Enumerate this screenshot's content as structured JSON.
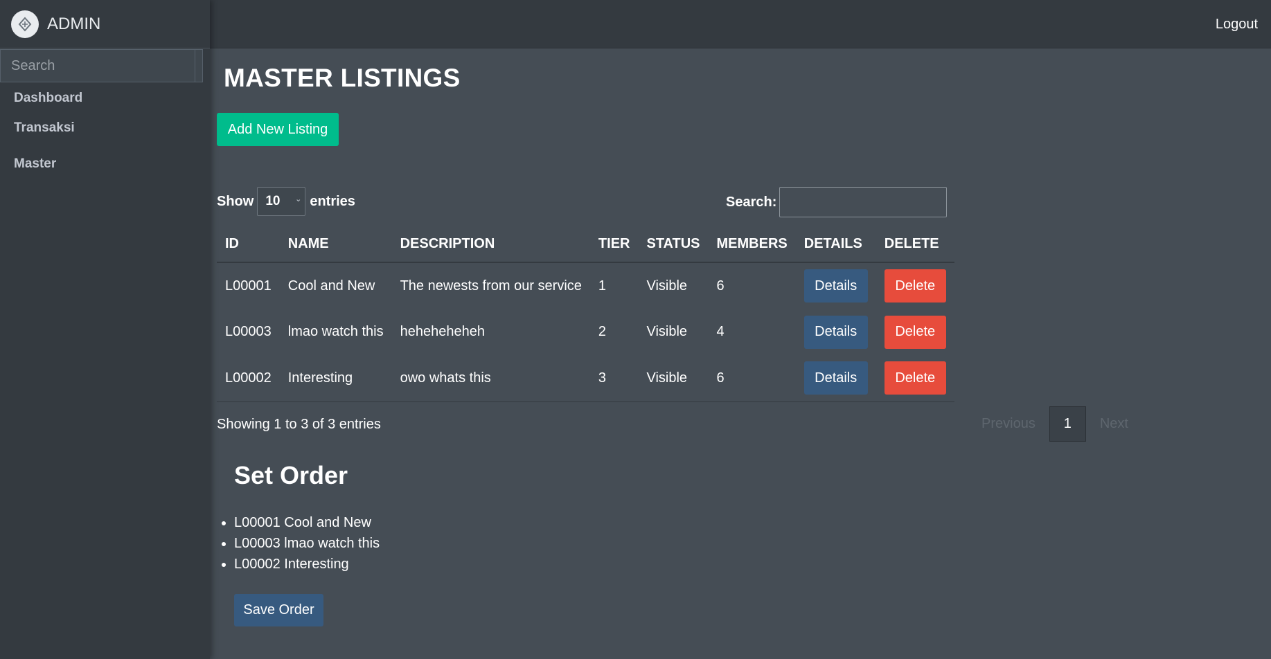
{
  "brand": {
    "logo_icon": "admin-logo-icon",
    "text": "ADMIN"
  },
  "sidebar": {
    "search_placeholder": "Search",
    "items": [
      {
        "label": "Dashboard"
      },
      {
        "label": "Transaksi"
      },
      {
        "label": "Master"
      }
    ]
  },
  "topbar": {
    "logout_label": "Logout"
  },
  "page": {
    "title": "MASTER LISTINGS",
    "add_button": "Add New Listing"
  },
  "datatable": {
    "show_label": "Show",
    "entries_value": "10",
    "entries_label": "entries",
    "search_label": "Search:",
    "search_value": "",
    "columns": [
      "ID",
      "NAME",
      "DESCRIPTION",
      "TIER",
      "STATUS",
      "MEMBERS",
      "DETAILS",
      "DELETE"
    ],
    "rows": [
      {
        "id": "L00001",
        "name": "Cool and New",
        "description": "The newests from our service",
        "tier": "1",
        "status": "Visible",
        "members": "6",
        "details": "Details",
        "delete": "Delete"
      },
      {
        "id": "L00003",
        "name": "lmao watch this",
        "description": "heheheheheh",
        "tier": "2",
        "status": "Visible",
        "members": "4",
        "details": "Details",
        "delete": "Delete"
      },
      {
        "id": "L00002",
        "name": "Interesting",
        "description": "owo whats this",
        "tier": "3",
        "status": "Visible",
        "members": "6",
        "details": "Details",
        "delete": "Delete"
      }
    ],
    "info": "Showing 1 to 3 of 3 entries",
    "pagination": {
      "previous": "Previous",
      "current": "1",
      "next": "Next"
    }
  },
  "set_order": {
    "title": "Set Order",
    "items": [
      "L00001 Cool and New",
      "L00003 lmao watch this",
      "L00002 Interesting"
    ],
    "save_button": "Save Order"
  },
  "colors": {
    "sidebar_bg": "#343a40",
    "content_bg": "#454d55",
    "success": "#00bc8c",
    "primary": "#375a7f",
    "danger": "#e74c3c"
  }
}
